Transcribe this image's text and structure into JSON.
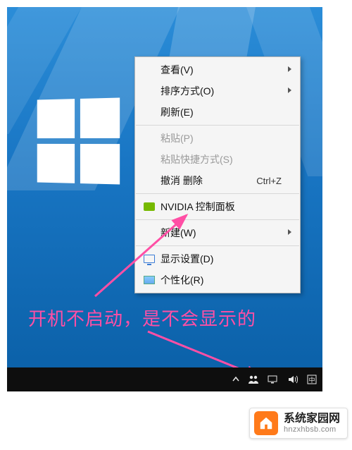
{
  "contextMenu": {
    "items": [
      {
        "label": "查看(V)",
        "submenu": true
      },
      {
        "label": "排序方式(O)",
        "submenu": true
      },
      {
        "label": "刷新(E)"
      },
      {
        "sep": true
      },
      {
        "label": "粘贴(P)",
        "disabled": true
      },
      {
        "label": "粘贴快捷方式(S)",
        "disabled": true
      },
      {
        "label": "撤消 删除",
        "accel": "Ctrl+Z"
      },
      {
        "sep": true
      },
      {
        "label": "NVIDIA 控制面板",
        "icon": "nvidia-icon"
      },
      {
        "sep": true
      },
      {
        "label": "新建(W)",
        "submenu": true
      },
      {
        "sep": true
      },
      {
        "label": "显示设置(D)",
        "icon": "monitor-icon"
      },
      {
        "label": "个性化(R)",
        "icon": "personalize-icon"
      }
    ]
  },
  "annotation": "开机不启动，是不会显示的",
  "badge": {
    "title": "系统家园网",
    "url": "hnzxhbsb.com"
  },
  "colors": {
    "accentPink": "#ff4fa5",
    "badgeOrange": "#ff7a1a"
  }
}
